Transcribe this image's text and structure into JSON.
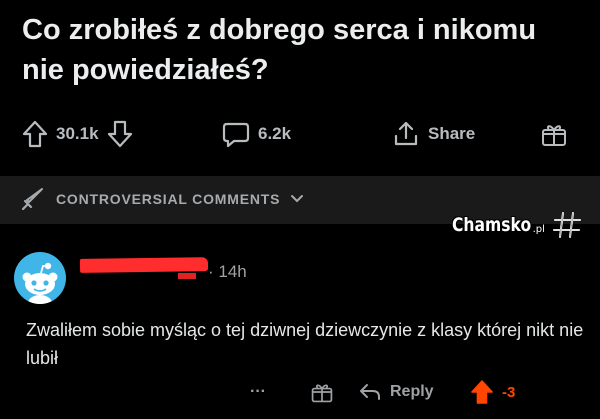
{
  "post": {
    "title": "Co zrobiłeś z dobrego serca i nikomu nie powiedziałeś?"
  },
  "actions": {
    "upvotes": "30.1k",
    "comments": "6.2k",
    "share_label": "Share"
  },
  "sort": {
    "label": "CONTROVERSIAL COMMENTS"
  },
  "watermark": {
    "brand": "Chamsko",
    "suffix": ".pl"
  },
  "comment": {
    "time": "· 14h",
    "text": "Zwaliłem sobie myśląc o tej dziwnej dziewczynie z klasy której nikt nie lubił",
    "more_label": "···",
    "reply_label": "Reply",
    "score": "-3"
  },
  "colors": {
    "background": "#000000",
    "sort_bar": "#1a1a1b",
    "avatar": "#3fb5e8",
    "upvote_active": "#ff4500",
    "redaction": "#ff2d2d"
  }
}
